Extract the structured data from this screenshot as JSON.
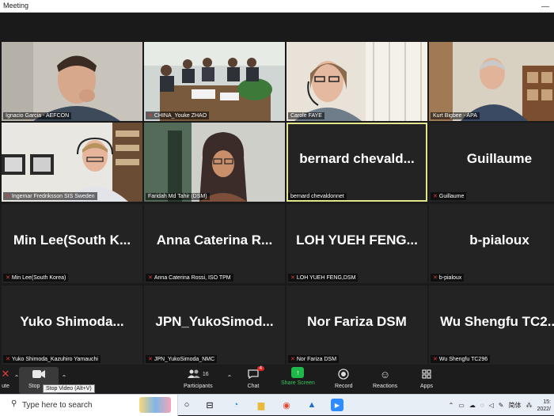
{
  "window": {
    "title": "Meeting",
    "minimize": "—"
  },
  "tiles": [
    {
      "name": "Ignacio Garcia - AEFCON",
      "muted": false
    },
    {
      "name": "CHINA_Youke ZHAO",
      "muted": true
    },
    {
      "name": "Carole FAYE",
      "muted": false
    },
    {
      "name": "Kurt Bigbee - APA",
      "muted": false
    },
    {
      "name": "Ingemar Fredriksson SIS Sweden",
      "muted": true
    },
    {
      "name": "Faridah Md Tahir (DSM)",
      "muted": false
    },
    {
      "big": "bernard  chevald...",
      "name": "bernard chevaldonnet",
      "muted": false,
      "active": true
    },
    {
      "big": "Guillaume",
      "name": "Guillaume",
      "muted": true
    },
    {
      "big": "Min Lee(South K...",
      "name": "Min Lee(South Korea)",
      "muted": true
    },
    {
      "big": "Anna Caterina R...",
      "name": "Anna Caterina Rossi, ISO TPM",
      "muted": true
    },
    {
      "big": "LOH YUEH FENG...",
      "name": "LOH YUEH FENG,DSM",
      "muted": true
    },
    {
      "big": "b-pialoux",
      "name": "b-pialoux",
      "muted": true
    },
    {
      "big": "Yuko  Shimoda...",
      "name": "Yuko Shimoda_Kazuhiro Yamauchi",
      "muted": true
    },
    {
      "big": "JPN_YukoSimod...",
      "name": "JPN_YukoSimoda_NMC",
      "muted": true
    },
    {
      "big": "Nor Fariza DSM",
      "name": "Nor Fariza DSM",
      "muted": true
    },
    {
      "big": "Wu Shengfu TC2...",
      "name": "Wu Shengfu TC296",
      "muted": true
    }
  ],
  "toolbar": {
    "unmute_label": "ute",
    "stop_video_label": "Stop",
    "stop_video_tooltip": "Stop Video (Alt+V)",
    "participants_label": "Participants",
    "participants_count": "16",
    "chat_label": "Chat",
    "chat_badge": "4",
    "share_label": "Share Screen",
    "record_label": "Record",
    "reactions_label": "Reactions",
    "apps_label": "Apps"
  },
  "taskbar": {
    "search_placeholder": "Type here to search",
    "ime": "简体",
    "time": "15:",
    "date": "2022/"
  },
  "colors": {
    "active_border": "#e3e58a",
    "share_green": "#1fb949",
    "muted_red": "#e23b3b",
    "badge_red": "#e02828"
  }
}
